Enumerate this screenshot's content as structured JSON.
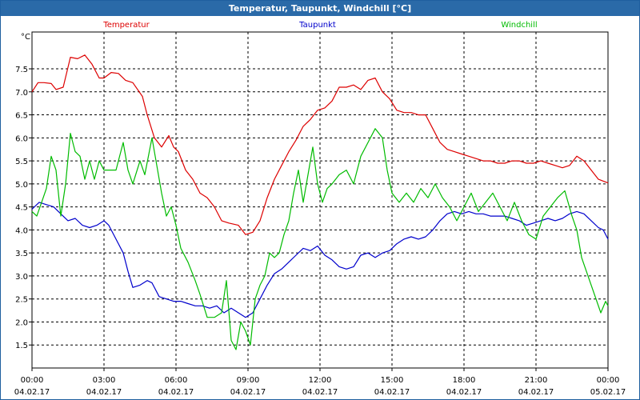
{
  "window": {
    "title": "Temperatur, Taupunkt, Windchill [°C]"
  },
  "chart_data": {
    "type": "line",
    "title": "Temperatur, Taupunkt, Windchill [°C]",
    "ylabel": "°C",
    "xlabel": "",
    "ylim": [
      1.0,
      8.3
    ],
    "xlim_hours": [
      0,
      24
    ],
    "grid": true,
    "legend_placement": "top",
    "y_ticks": [
      "1.5",
      "2.0",
      "2.5",
      "3.0",
      "3.5",
      "4.0",
      "4.5",
      "5.0",
      "5.5",
      "6.0",
      "6.5",
      "7.0",
      "7.5"
    ],
    "x_ticks": [
      {
        "time": "00:00",
        "date": "04.02.17"
      },
      {
        "time": "03:00",
        "date": "04.02.17"
      },
      {
        "time": "06:00",
        "date": "04.02.17"
      },
      {
        "time": "09:00",
        "date": "04.02.17"
      },
      {
        "time": "12:00",
        "date": "04.02.17"
      },
      {
        "time": "15:00",
        "date": "04.02.17"
      },
      {
        "time": "18:00",
        "date": "04.02.17"
      },
      {
        "time": "21:00",
        "date": "04.02.17"
      },
      {
        "time": "00:00",
        "date": "05.02.17"
      }
    ],
    "series": [
      {
        "name": "Temperatur",
        "color": "#dd0000",
        "points": [
          [
            0,
            7.0
          ],
          [
            0.25,
            7.2
          ],
          [
            0.5,
            7.2
          ],
          [
            0.8,
            7.18
          ],
          [
            1.0,
            7.05
          ],
          [
            1.3,
            7.1
          ],
          [
            1.6,
            7.75
          ],
          [
            1.9,
            7.72
          ],
          [
            2.2,
            7.8
          ],
          [
            2.5,
            7.6
          ],
          [
            2.8,
            7.3
          ],
          [
            3.0,
            7.3
          ],
          [
            3.3,
            7.42
          ],
          [
            3.6,
            7.4
          ],
          [
            3.9,
            7.25
          ],
          [
            4.2,
            7.2
          ],
          [
            4.6,
            6.9
          ],
          [
            4.8,
            6.5
          ],
          [
            5.1,
            6.0
          ],
          [
            5.4,
            5.8
          ],
          [
            5.7,
            6.05
          ],
          [
            5.9,
            5.8
          ],
          [
            6.1,
            5.7
          ],
          [
            6.4,
            5.3
          ],
          [
            6.7,
            5.1
          ],
          [
            7.0,
            4.8
          ],
          [
            7.3,
            4.7
          ],
          [
            7.6,
            4.5
          ],
          [
            7.9,
            4.2
          ],
          [
            8.2,
            4.15
          ],
          [
            8.6,
            4.1
          ],
          [
            8.9,
            3.9
          ],
          [
            9.2,
            3.95
          ],
          [
            9.5,
            4.2
          ],
          [
            9.8,
            4.7
          ],
          [
            10.1,
            5.1
          ],
          [
            10.4,
            5.4
          ],
          [
            10.7,
            5.7
          ],
          [
            11.0,
            5.95
          ],
          [
            11.3,
            6.25
          ],
          [
            11.6,
            6.4
          ],
          [
            11.9,
            6.6
          ],
          [
            12.2,
            6.65
          ],
          [
            12.5,
            6.8
          ],
          [
            12.8,
            7.1
          ],
          [
            13.1,
            7.1
          ],
          [
            13.4,
            7.15
          ],
          [
            13.7,
            7.05
          ],
          [
            14.0,
            7.25
          ],
          [
            14.3,
            7.3
          ],
          [
            14.6,
            7.0
          ],
          [
            14.9,
            6.85
          ],
          [
            15.2,
            6.6
          ],
          [
            15.5,
            6.55
          ],
          [
            15.8,
            6.55
          ],
          [
            16.1,
            6.5
          ],
          [
            16.4,
            6.5
          ],
          [
            16.7,
            6.2
          ],
          [
            17.0,
            5.9
          ],
          [
            17.3,
            5.75
          ],
          [
            17.6,
            5.7
          ],
          [
            17.9,
            5.65
          ],
          [
            18.2,
            5.6
          ],
          [
            18.5,
            5.55
          ],
          [
            18.8,
            5.5
          ],
          [
            19.1,
            5.5
          ],
          [
            19.4,
            5.45
          ],
          [
            19.7,
            5.45
          ],
          [
            20.0,
            5.5
          ],
          [
            20.3,
            5.5
          ],
          [
            20.6,
            5.45
          ],
          [
            20.9,
            5.45
          ],
          [
            21.2,
            5.5
          ],
          [
            21.5,
            5.45
          ],
          [
            21.8,
            5.4
          ],
          [
            22.1,
            5.35
          ],
          [
            22.4,
            5.4
          ],
          [
            22.7,
            5.6
          ],
          [
            23.0,
            5.5
          ],
          [
            23.3,
            5.3
          ],
          [
            23.6,
            5.1
          ],
          [
            24.0,
            5.02
          ]
        ]
      },
      {
        "name": "Taupunkt",
        "color": "#0000cc",
        "points": [
          [
            0,
            4.45
          ],
          [
            0.3,
            4.6
          ],
          [
            0.6,
            4.55
          ],
          [
            0.9,
            4.5
          ],
          [
            1.2,
            4.35
          ],
          [
            1.5,
            4.2
          ],
          [
            1.8,
            4.25
          ],
          [
            2.1,
            4.1
          ],
          [
            2.4,
            4.05
          ],
          [
            2.7,
            4.1
          ],
          [
            3.0,
            4.2
          ],
          [
            3.2,
            4.1
          ],
          [
            3.5,
            3.8
          ],
          [
            3.8,
            3.5
          ],
          [
            4.0,
            3.1
          ],
          [
            4.2,
            2.75
          ],
          [
            4.5,
            2.8
          ],
          [
            4.8,
            2.9
          ],
          [
            5.0,
            2.85
          ],
          [
            5.3,
            2.55
          ],
          [
            5.6,
            2.5
          ],
          [
            5.9,
            2.45
          ],
          [
            6.2,
            2.45
          ],
          [
            6.5,
            2.4
          ],
          [
            6.8,
            2.35
          ],
          [
            7.1,
            2.35
          ],
          [
            7.4,
            2.3
          ],
          [
            7.7,
            2.35
          ],
          [
            8.0,
            2.2
          ],
          [
            8.3,
            2.3
          ],
          [
            8.6,
            2.2
          ],
          [
            8.9,
            2.1
          ],
          [
            9.2,
            2.2
          ],
          [
            9.5,
            2.5
          ],
          [
            9.8,
            2.8
          ],
          [
            10.1,
            3.05
          ],
          [
            10.4,
            3.15
          ],
          [
            10.7,
            3.3
          ],
          [
            11.0,
            3.45
          ],
          [
            11.3,
            3.6
          ],
          [
            11.6,
            3.55
          ],
          [
            11.9,
            3.65
          ],
          [
            12.2,
            3.45
          ],
          [
            12.5,
            3.35
          ],
          [
            12.8,
            3.2
          ],
          [
            13.1,
            3.15
          ],
          [
            13.4,
            3.2
          ],
          [
            13.7,
            3.45
          ],
          [
            14.0,
            3.5
          ],
          [
            14.3,
            3.4
          ],
          [
            14.6,
            3.5
          ],
          [
            14.9,
            3.55
          ],
          [
            15.2,
            3.7
          ],
          [
            15.5,
            3.8
          ],
          [
            15.8,
            3.85
          ],
          [
            16.1,
            3.8
          ],
          [
            16.4,
            3.85
          ],
          [
            16.7,
            4.0
          ],
          [
            17.0,
            4.2
          ],
          [
            17.3,
            4.35
          ],
          [
            17.6,
            4.4
          ],
          [
            17.9,
            4.35
          ],
          [
            18.2,
            4.4
          ],
          [
            18.5,
            4.35
          ],
          [
            18.8,
            4.35
          ],
          [
            19.1,
            4.3
          ],
          [
            19.4,
            4.3
          ],
          [
            19.7,
            4.3
          ],
          [
            20.0,
            4.25
          ],
          [
            20.3,
            4.2
          ],
          [
            20.6,
            4.1
          ],
          [
            20.9,
            4.15
          ],
          [
            21.2,
            4.2
          ],
          [
            21.5,
            4.25
          ],
          [
            21.8,
            4.2
          ],
          [
            22.1,
            4.25
          ],
          [
            22.4,
            4.35
          ],
          [
            22.7,
            4.4
          ],
          [
            23.0,
            4.35
          ],
          [
            23.3,
            4.2
          ],
          [
            23.6,
            4.05
          ],
          [
            23.8,
            4.0
          ],
          [
            24.0,
            3.8
          ]
        ]
      },
      {
        "name": "Windchill",
        "color": "#00bb00",
        "points": [
          [
            0,
            4.4
          ],
          [
            0.2,
            4.3
          ],
          [
            0.4,
            4.6
          ],
          [
            0.6,
            4.9
          ],
          [
            0.8,
            5.6
          ],
          [
            1.0,
            5.3
          ],
          [
            1.2,
            4.3
          ],
          [
            1.4,
            5.0
          ],
          [
            1.6,
            6.1
          ],
          [
            1.8,
            5.7
          ],
          [
            2.0,
            5.6
          ],
          [
            2.2,
            5.1
          ],
          [
            2.4,
            5.5
          ],
          [
            2.6,
            5.1
          ],
          [
            2.8,
            5.5
          ],
          [
            3.0,
            5.3
          ],
          [
            3.2,
            5.3
          ],
          [
            3.5,
            5.3
          ],
          [
            3.8,
            5.9
          ],
          [
            4.0,
            5.3
          ],
          [
            4.2,
            5.0
          ],
          [
            4.5,
            5.5
          ],
          [
            4.7,
            5.2
          ],
          [
            5.0,
            6.0
          ],
          [
            5.2,
            5.4
          ],
          [
            5.4,
            4.8
          ],
          [
            5.6,
            4.3
          ],
          [
            5.8,
            4.5
          ],
          [
            6.0,
            4.1
          ],
          [
            6.2,
            3.6
          ],
          [
            6.5,
            3.3
          ],
          [
            6.8,
            2.9
          ],
          [
            7.0,
            2.6
          ],
          [
            7.3,
            2.1
          ],
          [
            7.6,
            2.1
          ],
          [
            7.9,
            2.2
          ],
          [
            8.1,
            2.9
          ],
          [
            8.3,
            1.6
          ],
          [
            8.5,
            1.4
          ],
          [
            8.7,
            2.0
          ],
          [
            8.9,
            1.8
          ],
          [
            9.1,
            1.5
          ],
          [
            9.3,
            2.5
          ],
          [
            9.5,
            2.8
          ],
          [
            9.7,
            3.0
          ],
          [
            9.9,
            3.5
          ],
          [
            10.1,
            3.4
          ],
          [
            10.3,
            3.5
          ],
          [
            10.5,
            3.9
          ],
          [
            10.7,
            4.2
          ],
          [
            10.9,
            4.8
          ],
          [
            11.1,
            5.3
          ],
          [
            11.3,
            4.6
          ],
          [
            11.5,
            5.2
          ],
          [
            11.7,
            5.8
          ],
          [
            11.9,
            5.0
          ],
          [
            12.1,
            4.6
          ],
          [
            12.3,
            4.9
          ],
          [
            12.5,
            5.0
          ],
          [
            12.8,
            5.2
          ],
          [
            13.1,
            5.3
          ],
          [
            13.4,
            5.0
          ],
          [
            13.7,
            5.6
          ],
          [
            14.0,
            5.9
          ],
          [
            14.3,
            6.2
          ],
          [
            14.6,
            6.0
          ],
          [
            14.8,
            5.3
          ],
          [
            15.0,
            4.8
          ],
          [
            15.3,
            4.6
          ],
          [
            15.6,
            4.8
          ],
          [
            15.9,
            4.6
          ],
          [
            16.2,
            4.9
          ],
          [
            16.5,
            4.7
          ],
          [
            16.8,
            5.0
          ],
          [
            17.1,
            4.7
          ],
          [
            17.4,
            4.5
          ],
          [
            17.7,
            4.2
          ],
          [
            18.0,
            4.5
          ],
          [
            18.3,
            4.8
          ],
          [
            18.6,
            4.4
          ],
          [
            18.9,
            4.6
          ],
          [
            19.2,
            4.8
          ],
          [
            19.5,
            4.5
          ],
          [
            19.8,
            4.2
          ],
          [
            20.1,
            4.6
          ],
          [
            20.4,
            4.2
          ],
          [
            20.7,
            3.9
          ],
          [
            21.0,
            3.8
          ],
          [
            21.3,
            4.3
          ],
          [
            21.6,
            4.5
          ],
          [
            21.9,
            4.7
          ],
          [
            22.2,
            4.85
          ],
          [
            22.5,
            4.3
          ],
          [
            22.7,
            4.0
          ],
          [
            22.9,
            3.4
          ],
          [
            23.1,
            3.1
          ],
          [
            23.3,
            2.8
          ],
          [
            23.5,
            2.5
          ],
          [
            23.7,
            2.2
          ],
          [
            23.9,
            2.45
          ],
          [
            24.0,
            2.35
          ]
        ]
      }
    ]
  }
}
